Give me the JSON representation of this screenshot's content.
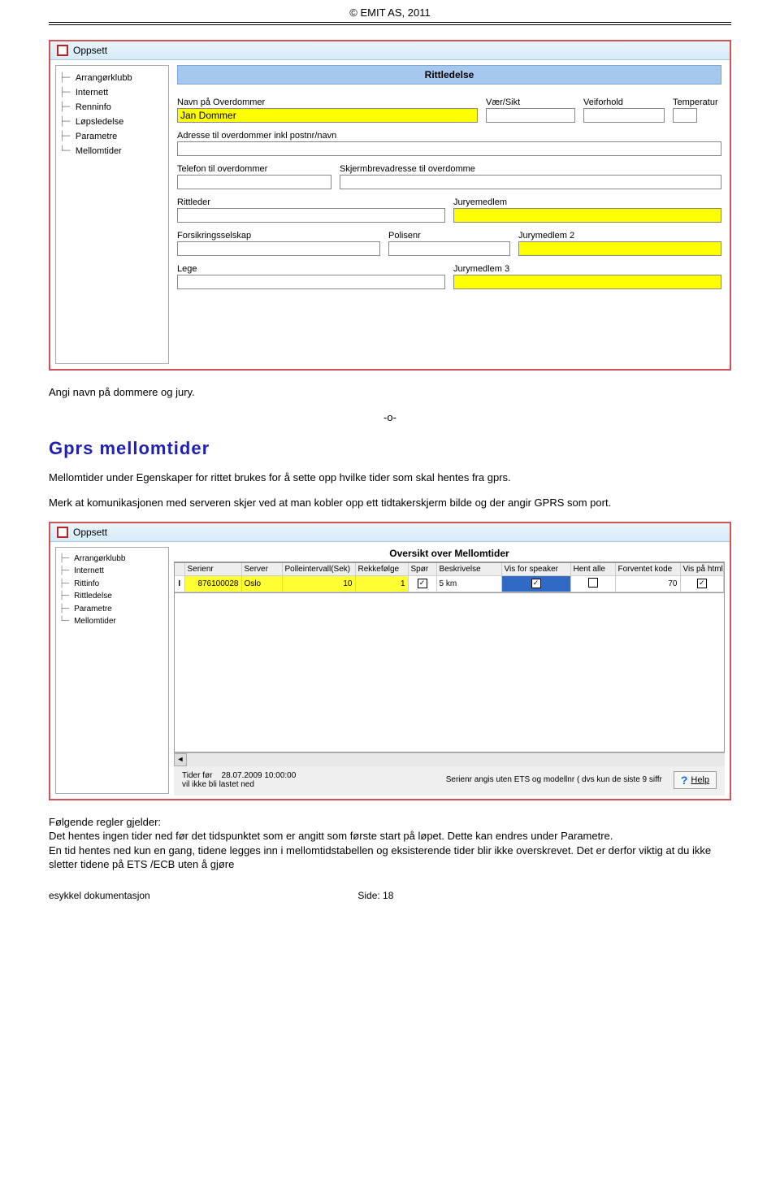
{
  "header": {
    "copyright": "© EMIT AS, 2011"
  },
  "window1": {
    "title": "Oppsett",
    "tree": [
      "Arrangørklubb",
      "Internett",
      "Renninfo",
      "Løpsledelse",
      "Parametre",
      "Mellomtider"
    ],
    "section_title": "Rittledelse",
    "fields": {
      "navn_label": "Navn på Overdommer",
      "navn_value": "Jan Dommer",
      "vaer_label": "Vær/Sikt",
      "vei_label": "Veiforhold",
      "temp_label": "Temperatur",
      "adresse_label": "Adresse til overdommer inkl postnr/navn",
      "telefon_label": "Telefon til overdommer",
      "skjerm_label": "Skjermbrevadresse til overdomme",
      "rittleder_label": "Rittleder",
      "jury1_label": "Juryemedlem",
      "forsikring_label": "Forsikringsselskap",
      "polise_label": "Polisenr",
      "jury2_label": "Jurymedlem 2",
      "lege_label": "Lege",
      "jury3_label": "Jurymedlem 3"
    }
  },
  "text": {
    "p1": "Angi navn på dommere og jury.",
    "sep": "-o-",
    "h2": "Gprs mellomtider",
    "p2": "Mellomtider under Egenskaper for rittet brukes for å sette opp hvilke tider som  skal hentes fra gprs.",
    "p3": "Merk at komunikasjonen med serveren skjer ved at man kobler opp ett tidtakerskjerm bilde og der angir GPRS som port."
  },
  "window2": {
    "title": "Oppsett",
    "tree": [
      "Arrangørklubb",
      "Internett",
      "Rittinfo",
      "Rittledelse",
      "Parametre",
      "Mellomtider"
    ],
    "grid_title": "Oversikt over Mellomtider",
    "columns": [
      "Serienr",
      "Server",
      "Polleintervall(Sek)",
      "Rekkefølge",
      "Spør",
      "Beskrivelse",
      "Vis for speaker",
      "Hent alle",
      "Forventet kode",
      "Vis på htmllister"
    ],
    "row": {
      "marker": "I",
      "serienr": "876100028",
      "server": "Oslo",
      "polle": "10",
      "rekke": "1",
      "spor_checked": true,
      "beskrivelse": "5 km",
      "vis_speaker_checked": true,
      "hent_alle_checked": false,
      "forventet_kode": "70",
      "vis_html_checked": true
    },
    "status": {
      "line1_a": "Tider før",
      "line1_b": "28.07.2009 10:00:00",
      "line2": "vil ikke bli lastet ned",
      "right": "Serienr angis uten ETS og modellnr ( dvs  kun de siste 9 siffr",
      "help": "Help"
    }
  },
  "text2": {
    "rules_heading": "Følgende regler gjelder:",
    "r1": "Det hentes ingen tider ned før det tidspunktet som er angitt som første start på løpet. Dette kan endres under Parametre.",
    "r2": "En tid hentes ned kun en gang, tidene legges inn i mellomtidstabellen og eksisterende tider blir ikke overskrevet. Det er derfor viktig at du ikke sletter tidene på ETS /ECB uten å gjøre"
  },
  "footer": {
    "left": "esykkel dokumentasjon",
    "center": "Side: 18"
  }
}
